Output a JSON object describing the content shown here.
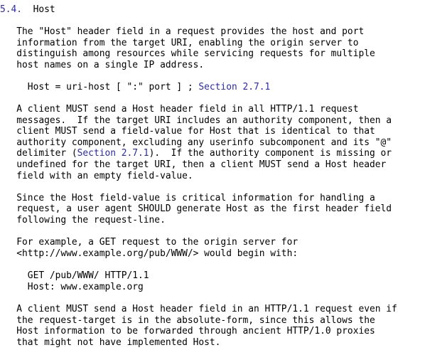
{
  "section": {
    "number": "5.4.",
    "title": "Host"
  },
  "para1": [
    "   The \"Host\" header field in a request provides the host and port",
    "   information from the target URI, enabling the origin server to",
    "   distinguish among resources while servicing requests for multiple",
    "   host names on a single IP address."
  ],
  "grammar": {
    "prefix": "     Host = uri-host [ \":\" port ] ; ",
    "link": "Section 2.7.1"
  },
  "para2": {
    "l1": "   A client MUST send a Host header field in all HTTP/1.1 request",
    "l2": "   messages.  If the target URI includes an authority component, then a",
    "l3": "   client MUST send a field-value for Host that is identical to that",
    "l4": "   authority component, excluding any userinfo subcomponent and its \"@\"",
    "l5_pre": "   delimiter (",
    "l5_link": "Section 2.7.1",
    "l5_post": ").  If the authority component is missing or",
    "l6": "   undefined for the target URI, then a client MUST send a Host header",
    "l7": "   field with an empty field-value."
  },
  "para3": [
    "   Since the Host field-value is critical information for handling a",
    "   request, a user agent SHOULD generate Host as the first header field",
    "   following the request-line."
  ],
  "para4": [
    "   For example, a GET request to the origin server for",
    "   <http://www.example.org/pub/WWW/> would begin with:"
  ],
  "example": [
    "     GET /pub/WWW/ HTTP/1.1",
    "     Host: www.example.org"
  ],
  "para5": [
    "   A client MUST send a Host header field in an HTTP/1.1 request even if",
    "   the request-target is in the absolute-form, since this allows the",
    "   Host information to be forwarded through ancient HTTP/1.0 proxies",
    "   that might not have implemented Host."
  ]
}
